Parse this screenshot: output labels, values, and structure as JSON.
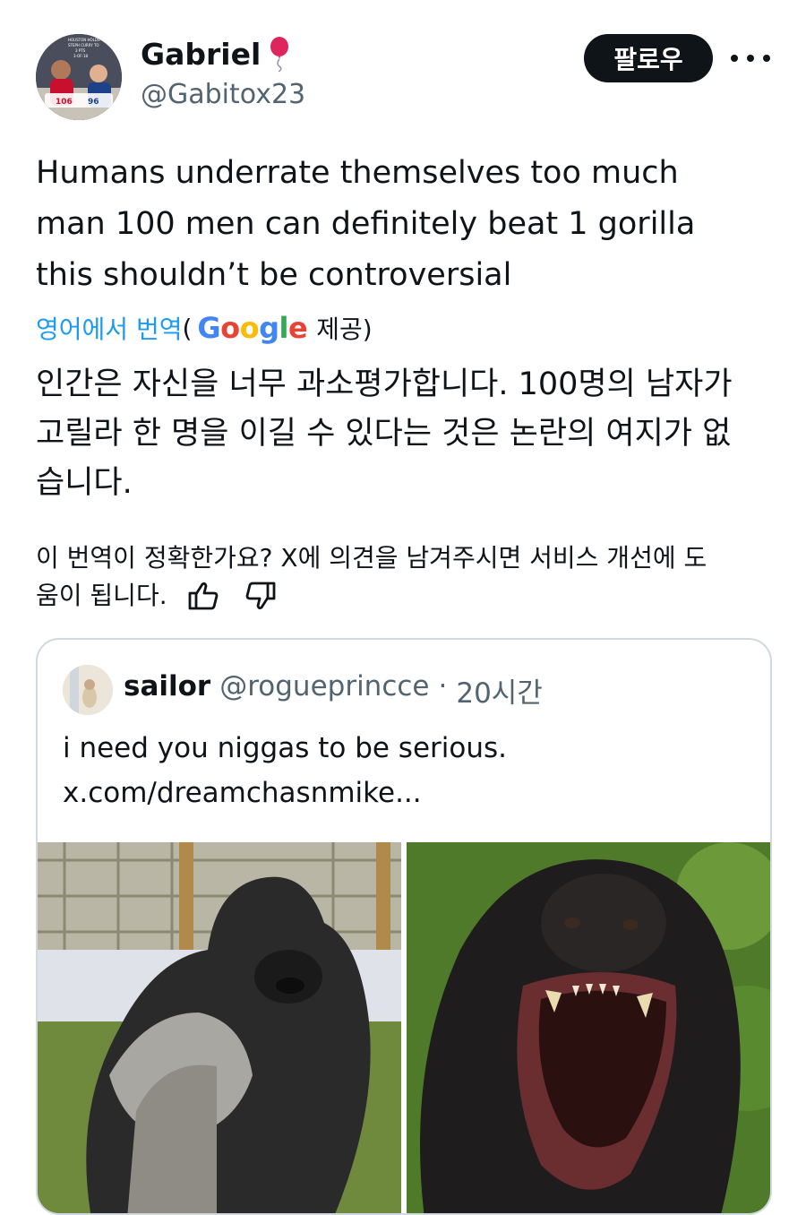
{
  "author": {
    "display_name": "Gabriel",
    "handle": "@Gabitox23",
    "avatar_icon": "basketball-player-avatar",
    "name_emoji_icon": "balloon-icon",
    "avatar_text": {
      "headline": [
        "HOUSTON HOLDS",
        "STEPH CURRY TO",
        "3 PTS",
        "3-OF-18"
      ],
      "score_left": "106",
      "score_right": "96"
    }
  },
  "actions": {
    "follow_label": "팔로우",
    "more_icon": "more-horizontal-icon"
  },
  "tweet": {
    "lines": [
      "Humans underrate themselves too much",
      "man 100 men can definitely beat 1 gorilla",
      "this shouldn’t be controversial"
    ]
  },
  "translation": {
    "link_label": "영어에서 번역",
    "paren_open": "(",
    "google_logo": "Google",
    "provided_label": "제공)",
    "lines": [
      "인간은 자신을 너무 과소평가합니다. 100명의 남자가",
      "고릴라 한 명을 이길 수 있다는 것은 논란의 여지가 없",
      "습니다."
    ]
  },
  "feedback": {
    "lines": [
      "이 번역이 정확한가요? X에 의견을 남겨주시면 서비스 개선에 도",
      "움이 됩니다."
    ],
    "thumb_up_icon": "thumbs-up-icon",
    "thumb_down_icon": "thumbs-down-icon"
  },
  "quote": {
    "display_name": "sailor",
    "handle": "@rogueprincce",
    "dot": "·",
    "time": "20시간",
    "lines": [
      "i need you niggas to be serious.",
      "x.com/dreamchasnmike..."
    ],
    "images": [
      "gorilla-standing-image",
      "gorilla-roaring-image"
    ]
  },
  "colors": {
    "text": "#0f1419",
    "secondary": "#536471",
    "link": "#1d9bf0",
    "border": "#cfd9de",
    "button_bg": "#0f1419"
  }
}
